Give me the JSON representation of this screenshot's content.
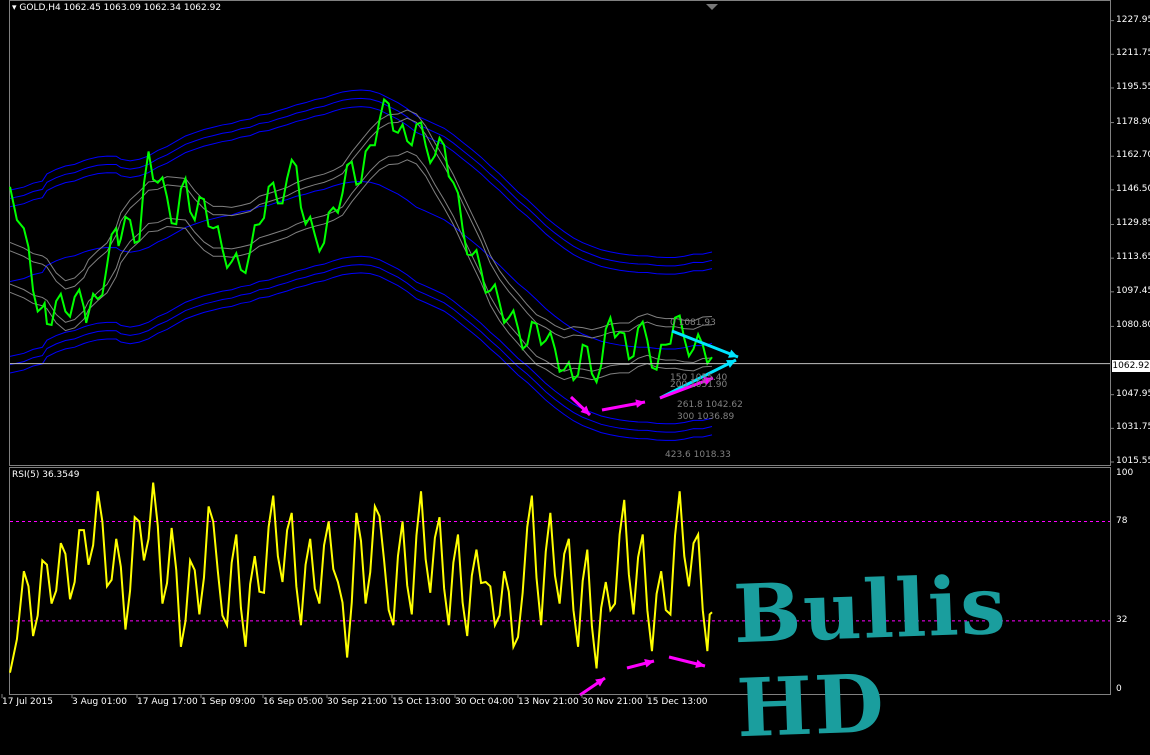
{
  "chart_data": [
    {
      "type": "line",
      "title": "GOLD,H4  1062.45 1063.09 1062.34 1062.92",
      "symbol": "GOLD",
      "timeframe": "H4",
      "ohlc": {
        "open": 1062.45,
        "high": 1063.09,
        "low": 1062.34,
        "close": 1062.92
      },
      "ylim": [
        1015.55,
        1235.0
      ],
      "y_ticks": [
        "1227.95",
        "1211.75",
        "1195.55",
        "1178.90",
        "1162.70",
        "1146.50",
        "1129.85",
        "1113.65",
        "1097.45",
        "1080.80",
        "1047.95",
        "1031.75",
        "1015.55"
      ],
      "current_price": "1062.92",
      "x_ticks": [
        "17 Jul 2015",
        "3 Aug 01:00",
        "17 Aug 17:00",
        "1 Sep 09:00",
        "16 Sep 05:00",
        "30 Sep 21:00",
        "15 Oct 13:00",
        "30 Oct 04:00",
        "13 Nov 21:00",
        "30 Nov 21:00",
        "15 Dec 13:00"
      ],
      "series": [
        {
          "color": "#00ff00",
          "points": [
            [
              0,
              1148
            ],
            [
              3,
              1128
            ],
            [
              5,
              1098
            ],
            [
              7,
              1090
            ],
            [
              8,
              1082
            ],
            [
              10,
              1093
            ],
            [
              12,
              1088
            ],
            [
              14,
              1095
            ],
            [
              16,
              1090
            ],
            [
              17,
              1087
            ],
            [
              19,
              1094
            ],
            [
              21,
              1110
            ],
            [
              23,
              1128
            ],
            [
              24,
              1123
            ],
            [
              26,
              1132
            ],
            [
              28,
              1122
            ],
            [
              30,
              1165
            ],
            [
              32,
              1150
            ],
            [
              34,
              1143
            ],
            [
              36,
              1130
            ],
            [
              38,
              1152
            ],
            [
              40,
              1132
            ],
            [
              42,
              1142
            ],
            [
              44,
              1128
            ],
            [
              46,
              1118
            ],
            [
              48,
              1112
            ],
            [
              50,
              1108
            ],
            [
              52,
              1117
            ],
            [
              54,
              1130
            ],
            [
              56,
              1148
            ],
            [
              58,
              1140
            ],
            [
              60,
              1152
            ],
            [
              62,
              1158
            ],
            [
              64,
              1130
            ],
            [
              66,
              1125
            ],
            [
              68,
              1121
            ],
            [
              70,
              1138
            ],
            [
              72,
              1145
            ],
            [
              74,
              1160
            ],
            [
              76,
              1150
            ],
            [
              78,
              1168
            ],
            [
              80,
              1180
            ],
            [
              82,
              1188
            ],
            [
              84,
              1174
            ],
            [
              86,
              1170
            ],
            [
              88,
              1178
            ],
            [
              90,
              1168
            ],
            [
              92,
              1163
            ],
            [
              94,
              1168
            ],
            [
              96,
              1150
            ],
            [
              98,
              1128
            ],
            [
              100,
              1115
            ],
            [
              102,
              1108
            ],
            [
              104,
              1098
            ],
            [
              106,
              1092
            ],
            [
              108,
              1085
            ],
            [
              110,
              1080
            ],
            [
              112,
              1072
            ],
            [
              114,
              1082
            ],
            [
              116,
              1074
            ],
            [
              118,
              1070
            ],
            [
              120,
              1060
            ],
            [
              122,
              1055
            ],
            [
              124,
              1072
            ],
            [
              126,
              1058
            ],
            [
              128,
              1062
            ],
            [
              130,
              1085
            ],
            [
              132,
              1078
            ],
            [
              134,
              1065
            ],
            [
              136,
              1080
            ],
            [
              138,
              1074
            ],
            [
              140,
              1060
            ],
            [
              142,
              1072
            ],
            [
              144,
              1085
            ],
            [
              146,
              1075
            ],
            [
              148,
              1070
            ],
            [
              150,
              1072
            ],
            [
              152,
              1066
            ]
          ]
        }
      ],
      "fib_levels": [
        {
          "label": "0 1081.93",
          "value": 1081.93
        },
        {
          "label": "150 1055.40",
          "value": 1055.4
        },
        {
          "label": "200 1051.90",
          "value": 1051.9
        },
        {
          "label": "261.8 1042.62",
          "value": 1042.62
        },
        {
          "label": "300 1036.89",
          "value": 1036.89
        },
        {
          "label": "423.6 1018.33",
          "value": 1018.33
        }
      ]
    },
    {
      "type": "line",
      "title": "RSI(5) 36.3549",
      "indicator": "RSI(5)",
      "value": "36.3549",
      "ylim": [
        0,
        100
      ],
      "y_ticks": [
        "100",
        "78",
        "32",
        "0"
      ],
      "levels": [
        78,
        32
      ],
      "series": [
        {
          "color": "#ffff00",
          "points": [
            [
              0,
              8
            ],
            [
              3,
              55
            ],
            [
              5,
              25
            ],
            [
              7,
              60
            ],
            [
              9,
              40
            ],
            [
              11,
              68
            ],
            [
              13,
              42
            ],
            [
              15,
              74
            ],
            [
              17,
              58
            ],
            [
              19,
              92
            ],
            [
              21,
              48
            ],
            [
              23,
              70
            ],
            [
              25,
              28
            ],
            [
              27,
              80
            ],
            [
              29,
              60
            ],
            [
              31,
              96
            ],
            [
              33,
              40
            ],
            [
              35,
              75
            ],
            [
              37,
              20
            ],
            [
              39,
              60
            ],
            [
              41,
              35
            ],
            [
              43,
              85
            ],
            [
              45,
              55
            ],
            [
              47,
              30
            ],
            [
              49,
              72
            ],
            [
              51,
              20
            ],
            [
              53,
              62
            ],
            [
              55,
              45
            ],
            [
              57,
              90
            ],
            [
              59,
              50
            ],
            [
              61,
              82
            ],
            [
              63,
              30
            ],
            [
              65,
              70
            ],
            [
              67,
              40
            ],
            [
              69,
              78
            ],
            [
              71,
              50
            ],
            [
              73,
              15
            ],
            [
              75,
              82
            ],
            [
              77,
              40
            ],
            [
              79,
              85
            ],
            [
              81,
              60
            ],
            [
              83,
              30
            ],
            [
              85,
              78
            ],
            [
              87,
              35
            ],
            [
              89,
              92
            ],
            [
              91,
              45
            ],
            [
              93,
              80
            ],
            [
              95,
              30
            ],
            [
              97,
              72
            ],
            [
              99,
              25
            ],
            [
              101,
              65
            ],
            [
              103,
              50
            ],
            [
              105,
              30
            ],
            [
              107,
              55
            ],
            [
              109,
              20
            ],
            [
              111,
              45
            ],
            [
              113,
              90
            ],
            [
              115,
              30
            ],
            [
              117,
              82
            ],
            [
              119,
              40
            ],
            [
              121,
              70
            ],
            [
              123,
              20
            ],
            [
              125,
              65
            ],
            [
              127,
              10
            ],
            [
              129,
              50
            ],
            [
              131,
              40
            ],
            [
              133,
              88
            ],
            [
              135,
              35
            ],
            [
              137,
              72
            ],
            [
              139,
              18
            ],
            [
              141,
              55
            ],
            [
              143,
              35
            ],
            [
              145,
              92
            ],
            [
              147,
              48
            ],
            [
              149,
              72
            ],
            [
              151,
              18
            ],
            [
              152,
              36
            ]
          ]
        }
      ]
    }
  ],
  "rsi_value_label": "RSI(5) 36.3549",
  "price_header": "GOLD,H4  1062.45 1063.09 1062.34 1062.92",
  "watermark_text": "Bullis HD",
  "colors": {
    "background": "#000000",
    "price_line": "#00ff00",
    "envelope": "#0000ff",
    "envelope_gray": "#808080",
    "rsi_line": "#ffff00",
    "rsi_level": "#ff00ff",
    "arrow_cyan": "#00e5ff",
    "arrow_magenta": "#ff00ff",
    "watermark": "#1a9e9e"
  }
}
